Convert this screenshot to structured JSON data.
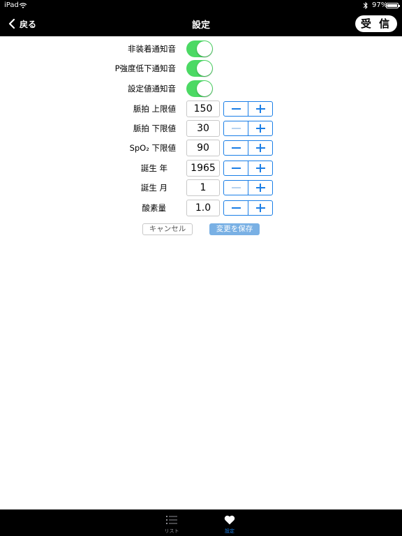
{
  "status": {
    "device": "iPad",
    "battery": "97%"
  },
  "nav": {
    "back_label": "戻る",
    "title": "設定",
    "receive_label": "受 信"
  },
  "toggles": [
    {
      "label": "非装着通知音",
      "on": true
    },
    {
      "label": "P強度低下通知音",
      "on": true
    },
    {
      "label": "設定値通知音",
      "on": true
    }
  ],
  "steppers": [
    {
      "label": "脈拍 上限値",
      "value": "150"
    },
    {
      "label": "脈拍 下限値",
      "value": "30"
    },
    {
      "label": "SpO₂ 下限値",
      "value": "90"
    },
    {
      "label": "誕生 年",
      "value": "1965"
    },
    {
      "label": "誕生 月",
      "value": "1"
    },
    {
      "label": "酸素量",
      "value": "1.0"
    }
  ],
  "actions": {
    "cancel_label": "キャンセル",
    "save_label": "変更を保存"
  },
  "tabs": [
    {
      "label": "リスト"
    },
    {
      "label": "設定"
    }
  ],
  "colors": {
    "toggle_on": "#4cd964",
    "accent": "#1a7ee6",
    "save_button": "#79b0e4"
  }
}
